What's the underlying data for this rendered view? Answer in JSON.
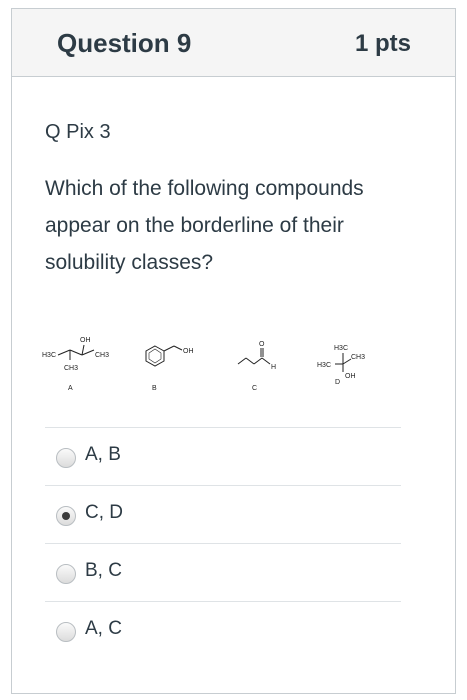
{
  "question": {
    "title": "Question 9",
    "points": "1 pts",
    "subtitle": "Q Pix 3",
    "text": "Which of the following compounds appear on the borderline of their solubility classes?"
  },
  "structures": [
    {
      "label": "A",
      "atoms": [
        "OH",
        "H3C",
        "CH3",
        "CH3"
      ]
    },
    {
      "label": "B",
      "atoms": [
        "OH"
      ]
    },
    {
      "label": "C",
      "atoms": [
        "O",
        "H"
      ]
    },
    {
      "label": "D",
      "atoms": [
        "H3C",
        "CH3",
        "H3C",
        "OH"
      ]
    }
  ],
  "answers": [
    {
      "label": "A, B",
      "selected": false
    },
    {
      "label": "C, D",
      "selected": true
    },
    {
      "label": "B, C",
      "selected": false
    },
    {
      "label": "A, C",
      "selected": false
    }
  ]
}
